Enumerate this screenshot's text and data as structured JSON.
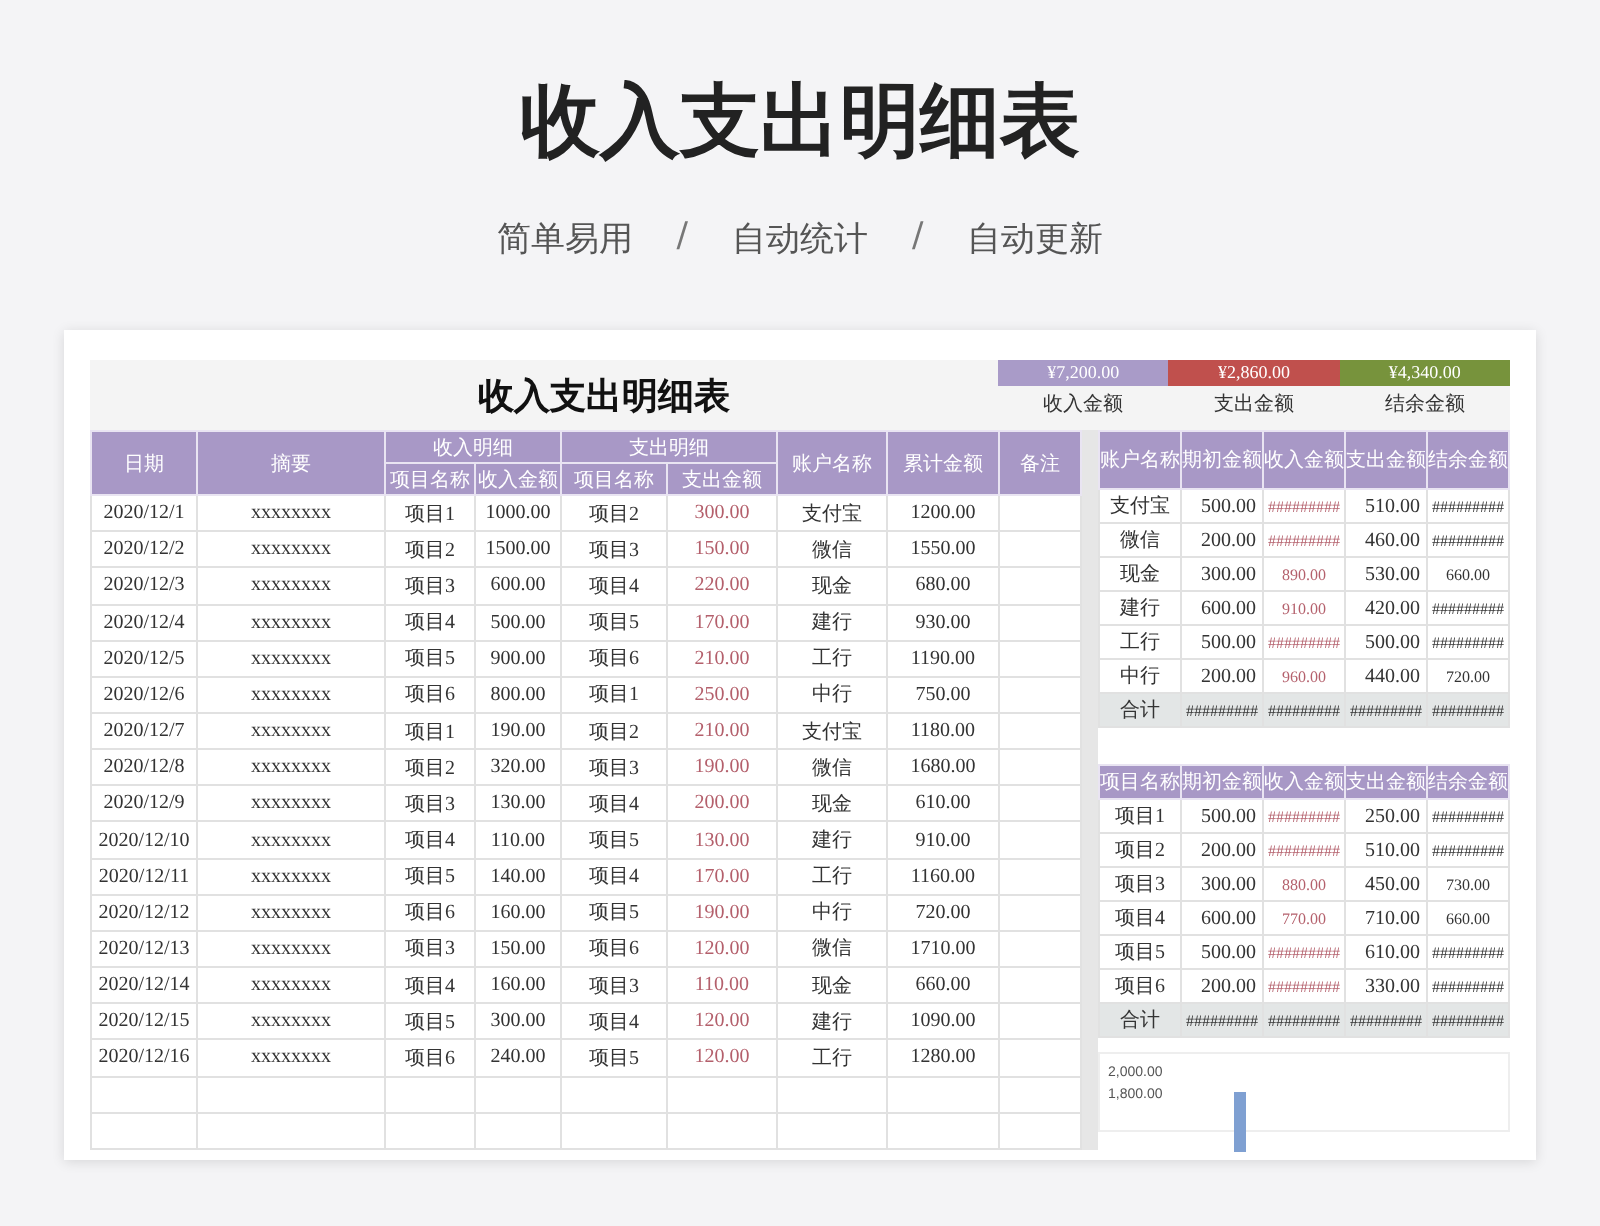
{
  "page_title": "收入支出明细表",
  "subtitle": [
    {
      "kind": "text",
      "text": "简单易用"
    },
    {
      "kind": "separator",
      "text": "/"
    },
    {
      "kind": "text",
      "text": "自动统计"
    },
    {
      "kind": "separator",
      "text": "/"
    },
    {
      "kind": "text",
      "text": "自动更新"
    }
  ],
  "sheet": {
    "title": "收入支出明细表",
    "summary": [
      {
        "value": "¥7,200.00",
        "label": "收入金额",
        "color": "#a99bc8"
      },
      {
        "value": "¥2,860.00",
        "label": "支出金额",
        "color": "#c0504d"
      },
      {
        "value": "¥4,340.00",
        "label": "结余金额",
        "color": "#77933c"
      }
    ],
    "ledger": {
      "header_rows": [
        [
          {
            "text": "日期",
            "rowspan": 2
          },
          {
            "text": "摘要",
            "rowspan": 2
          },
          {
            "text": "收入明细",
            "colspan": 2
          },
          {
            "text": "支出明细",
            "colspan": 2
          },
          {
            "text": "账户名称",
            "rowspan": 2
          },
          {
            "text": "累计金额",
            "rowspan": 2
          },
          {
            "text": "备注",
            "rowspan": 2
          }
        ],
        [
          {
            "text": "项目名称"
          },
          {
            "text": "收入金额"
          },
          {
            "text": "项目名称"
          },
          {
            "text": "支出金额"
          }
        ]
      ],
      "rows": [
        [
          "2020/12/1",
          "xxxxxxxx",
          "项目1",
          "1000.00",
          "项目2",
          "300.00",
          "支付宝",
          "1200.00"
        ],
        [
          "2020/12/2",
          "xxxxxxxx",
          "项目2",
          "1500.00",
          "项目3",
          "150.00",
          "微信",
          "1550.00"
        ],
        [
          "2020/12/3",
          "xxxxxxxx",
          "项目3",
          "600.00",
          "项目4",
          "220.00",
          "现金",
          "680.00"
        ],
        [
          "2020/12/4",
          "xxxxxxxx",
          "项目4",
          "500.00",
          "项目5",
          "170.00",
          "建行",
          "930.00"
        ],
        [
          "2020/12/5",
          "xxxxxxxx",
          "项目5",
          "900.00",
          "项目6",
          "210.00",
          "工行",
          "1190.00"
        ],
        [
          "2020/12/6",
          "xxxxxxxx",
          "项目6",
          "800.00",
          "项目1",
          "250.00",
          "中行",
          "750.00"
        ],
        [
          "2020/12/7",
          "xxxxxxxx",
          "项目1",
          "190.00",
          "项目2",
          "210.00",
          "支付宝",
          "1180.00"
        ],
        [
          "2020/12/8",
          "xxxxxxxx",
          "项目2",
          "320.00",
          "项目3",
          "190.00",
          "微信",
          "1680.00"
        ],
        [
          "2020/12/9",
          "xxxxxxxx",
          "项目3",
          "130.00",
          "项目4",
          "200.00",
          "现金",
          "610.00"
        ],
        [
          "2020/12/10",
          "xxxxxxxx",
          "项目4",
          "110.00",
          "项目5",
          "130.00",
          "建行",
          "910.00"
        ],
        [
          "2020/12/11",
          "xxxxxxxx",
          "项目5",
          "140.00",
          "项目4",
          "170.00",
          "工行",
          "1160.00"
        ],
        [
          "2020/12/12",
          "xxxxxxxx",
          "项目6",
          "160.00",
          "项目5",
          "190.00",
          "中行",
          "720.00"
        ],
        [
          "2020/12/13",
          "xxxxxxxx",
          "项目3",
          "150.00",
          "项目6",
          "120.00",
          "微信",
          "1710.00"
        ],
        [
          "2020/12/14",
          "xxxxxxxx",
          "项目4",
          "160.00",
          "项目3",
          "110.00",
          "现金",
          "660.00"
        ],
        [
          "2020/12/15",
          "xxxxxxxx",
          "项目5",
          "300.00",
          "项目4",
          "120.00",
          "建行",
          "1090.00"
        ],
        [
          "2020/12/16",
          "xxxxxxxx",
          "项目6",
          "240.00",
          "项目5",
          "120.00",
          "工行",
          "1280.00"
        ]
      ]
    },
    "accounts": {
      "columns": [
        "账户名称",
        "期初金额",
        "收入金额",
        "支出金额",
        "结余金额"
      ],
      "rows": [
        [
          "支付宝",
          "500.00",
          "#########",
          "510.00",
          "#########"
        ],
        [
          "微信",
          "200.00",
          "#########",
          "460.00",
          "#########"
        ],
        [
          "现金",
          "300.00",
          "890.00",
          "530.00",
          "660.00"
        ],
        [
          "建行",
          "600.00",
          "910.00",
          "420.00",
          "#########"
        ],
        [
          "工行",
          "500.00",
          "#########",
          "500.00",
          "#########"
        ],
        [
          "中行",
          "200.00",
          "960.00",
          "440.00",
          "720.00"
        ]
      ],
      "total": [
        "合计",
        "#########",
        "#########",
        "#########",
        "#########"
      ]
    },
    "projects": {
      "columns": [
        "项目名称",
        "期初金额",
        "收入金额",
        "支出金额",
        "结余金额"
      ],
      "rows": [
        [
          "项目1",
          "500.00",
          "#########",
          "250.00",
          "#########"
        ],
        [
          "项目2",
          "200.00",
          "#########",
          "510.00",
          "#########"
        ],
        [
          "项目3",
          "300.00",
          "880.00",
          "450.00",
          "730.00"
        ],
        [
          "项目4",
          "600.00",
          "770.00",
          "710.00",
          "660.00"
        ],
        [
          "项目5",
          "500.00",
          "#########",
          "610.00",
          "#########"
        ],
        [
          "项目6",
          "200.00",
          "#########",
          "330.00",
          "#########"
        ]
      ],
      "total": [
        "合计",
        "#########",
        "#########",
        "#########",
        "#########"
      ]
    },
    "chart": {
      "y_tick_labels": [
        "2,000.00",
        "1,800.00"
      ]
    }
  }
}
